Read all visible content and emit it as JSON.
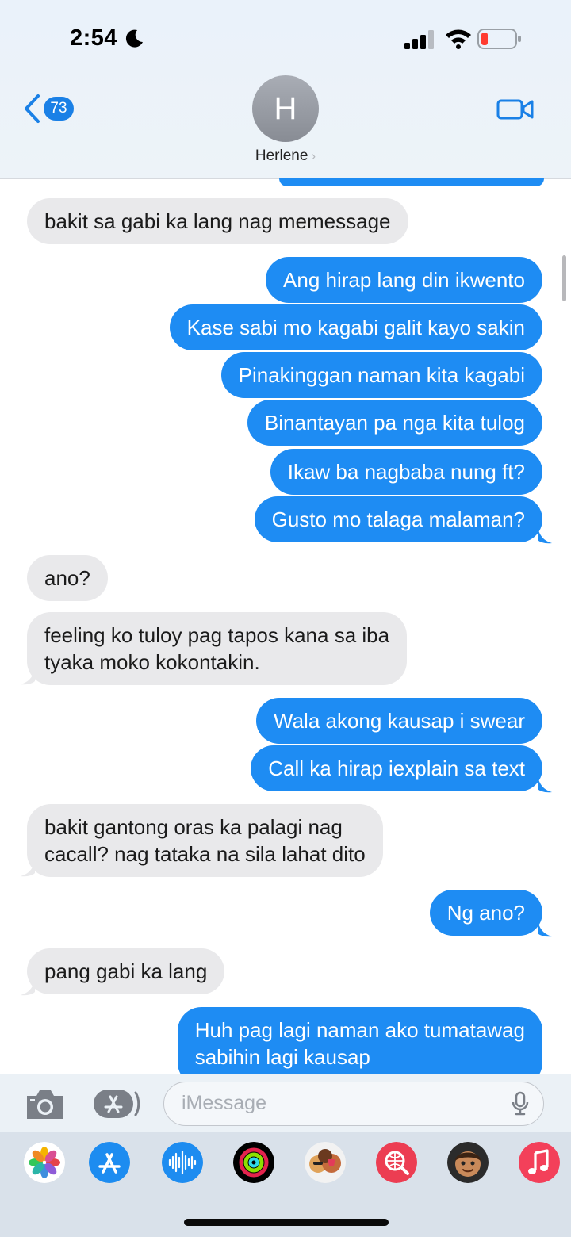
{
  "status_bar": {
    "time": "2:54",
    "icons": [
      "moon-icon",
      "signal-icon",
      "wifi-icon",
      "battery-low-icon"
    ]
  },
  "header": {
    "back_count": "73",
    "avatar_initial": "H",
    "contact_name": "Herlene",
    "contact_chevron": "›"
  },
  "messages": [
    {
      "dir": "in",
      "text": "bakit sa gabi ka lang nag memessage"
    },
    {
      "dir": "out",
      "text": "Ang hirap lang din ikwento"
    },
    {
      "dir": "out",
      "text": "Kase sabi mo kagabi galit kayo sakin"
    },
    {
      "dir": "out",
      "text": "Pinakinggan naman kita kagabi"
    },
    {
      "dir": "out",
      "text": "Binantayan pa nga kita tulog"
    },
    {
      "dir": "out",
      "text": "Ikaw ba nagbaba nung ft?"
    },
    {
      "dir": "out",
      "text": "Gusto mo talaga malaman?"
    },
    {
      "dir": "in",
      "text": "ano?"
    },
    {
      "dir": "in",
      "text": "feeling ko tuloy pag tapos kana sa iba",
      "text2": "tyaka moko kokontakin."
    },
    {
      "dir": "out",
      "text": "Wala akong kausap i swear"
    },
    {
      "dir": "out",
      "text": "Call ka hirap iexplain sa text"
    },
    {
      "dir": "in",
      "text": "bakit gantong oras ka palagi nag",
      "text2": "cacall? nag tataka na sila lahat dito"
    },
    {
      "dir": "out",
      "text": "Ng ano?"
    },
    {
      "dir": "in",
      "text": "pang gabi ka lang"
    },
    {
      "dir": "out",
      "text": "Huh pag lagi naman ako tumatawag",
      "text2": "sabihin lagi kausap"
    }
  ],
  "composer": {
    "placeholder": "iMessage"
  },
  "app_strip": [
    "photos-icon",
    "app-store-icon",
    "audio-message-icon",
    "activity-icon",
    "stickers-icon",
    "web-search-icon",
    "memoji-icon",
    "music-icon"
  ],
  "colors": {
    "outgoing": "#1e8cf3",
    "incoming": "#e9e9eb",
    "accent": "#1a80e6"
  }
}
